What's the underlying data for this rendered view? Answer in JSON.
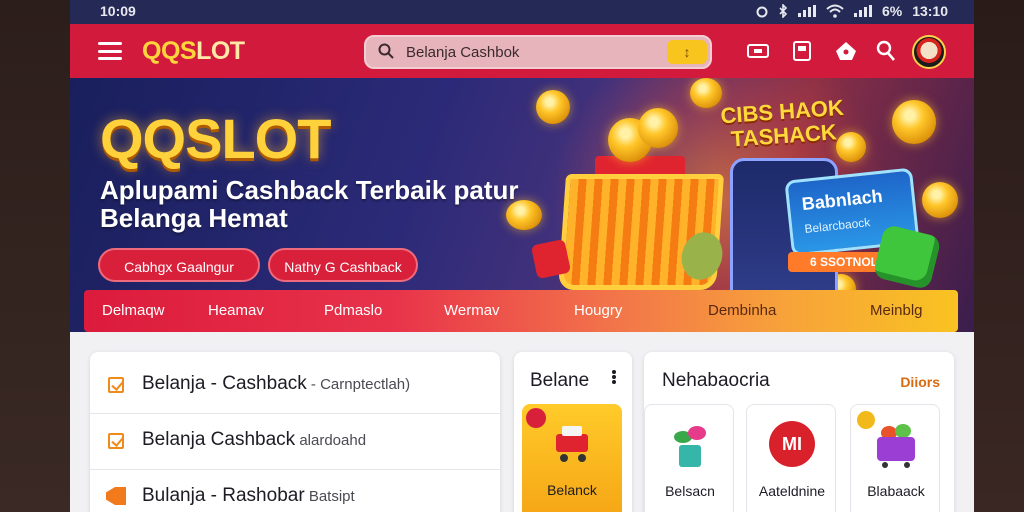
{
  "status_bar": {
    "time": "10:09",
    "battery": "6%",
    "clock_right": "13:10"
  },
  "header": {
    "brand_part1": "QQS",
    "brand_part2": "LOT",
    "search_value": "Belanja Cashbok",
    "search_button": "↕",
    "icons": [
      "ticket-icon",
      "wallet-icon",
      "tag-icon",
      "search-user-icon",
      "avatar"
    ]
  },
  "banner": {
    "logo": "QQSLOT",
    "title": "Aplupami Cashback Terbaik patur Belanga Hemat",
    "button1": "Cabhgx Gaalngur",
    "button2": "Nathy G Cashback",
    "sign": "CIBS HAOK TASHACK",
    "card_title": "Babnlach",
    "card_sub": "Belarcbaock",
    "promo_tag": "6 SSOTNOL"
  },
  "categories": [
    "Delmaqw",
    "Heamav",
    "Pdmaslo",
    "Wermav",
    "Hougry",
    "Dembinha",
    "Meinblg"
  ],
  "list_panel": {
    "rows": [
      {
        "main": "Belanja - Cashback",
        "sub": " - Carnptectlah)"
      },
      {
        "main": "Belanja Cashback",
        "sub": " alardoahd"
      },
      {
        "main": "Bulanja - Rashobar",
        "sub": " Batsipt"
      }
    ]
  },
  "mid_panel": {
    "title": "Belane",
    "card_label": "Belanck"
  },
  "right_panel": {
    "title": "Nehabaocria",
    "link": "Diiors",
    "tiles": [
      "Belsacn",
      "Aateldnine",
      "Blabaack"
    ],
    "mi_text": "MI"
  },
  "colors": {
    "header_red": "#d21a3c",
    "accent_yellow": "#ffd23b",
    "orange": "#f08a1c"
  }
}
